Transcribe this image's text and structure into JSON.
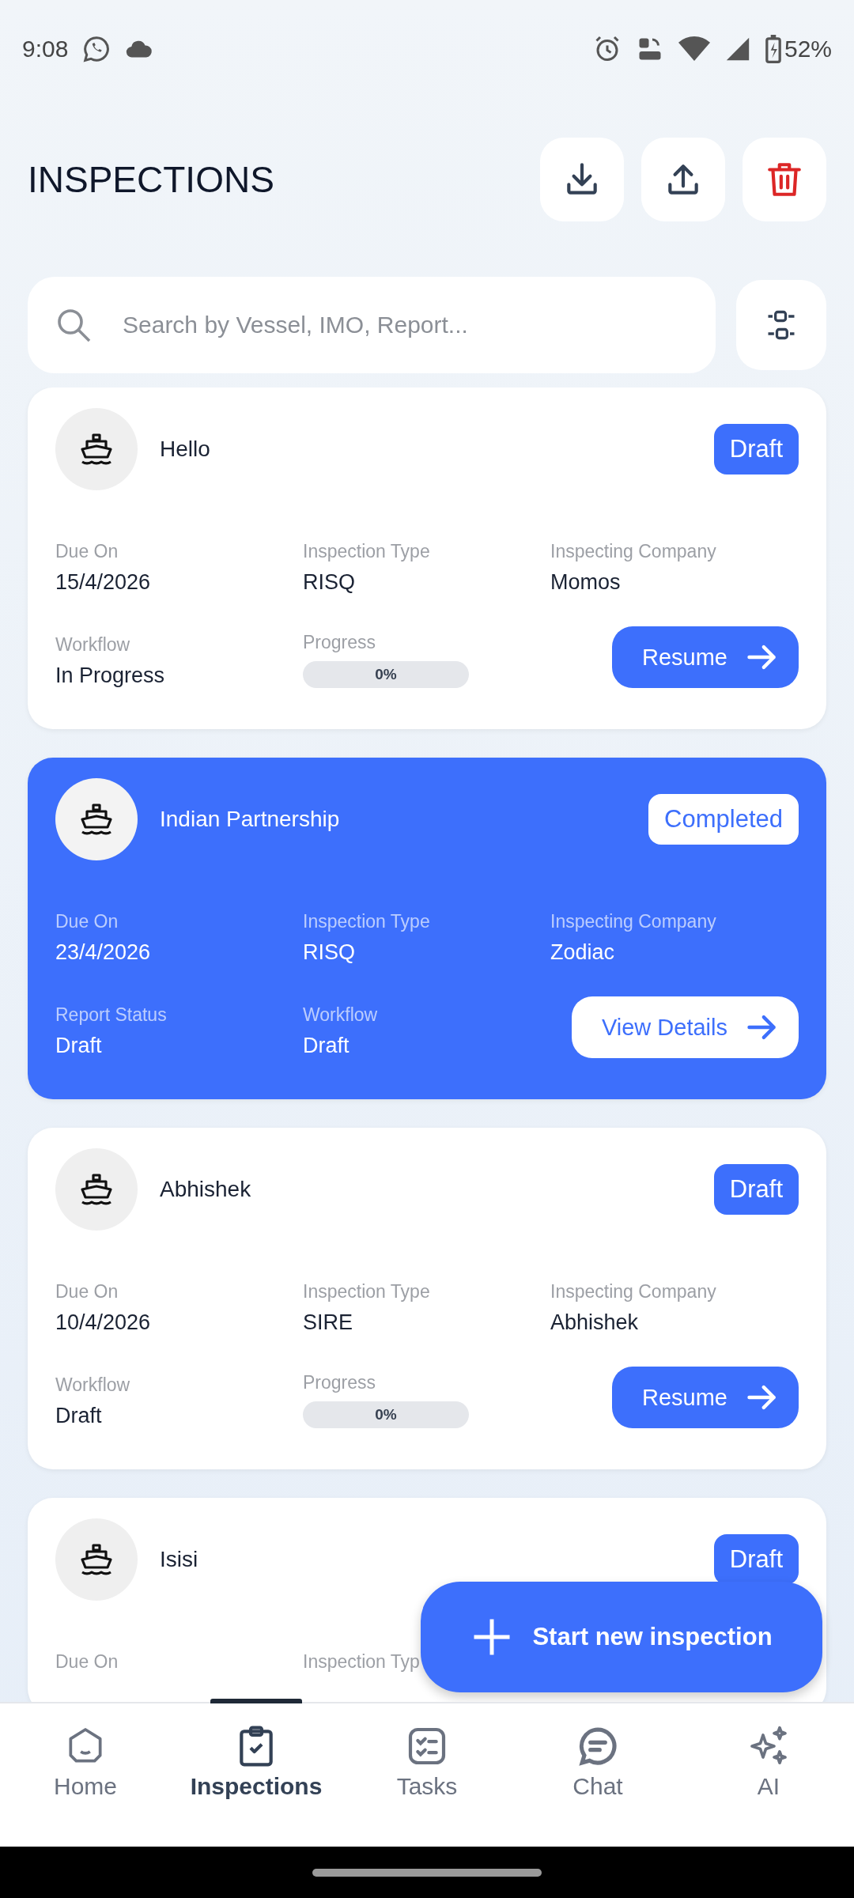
{
  "status_bar": {
    "time": "9:08",
    "battery": "52%"
  },
  "header": {
    "title": "INSPECTIONS"
  },
  "search": {
    "placeholder": "Search by Vessel, IMO, Report..."
  },
  "cards": [
    {
      "name": "Hello",
      "status": "Draft",
      "selected": false,
      "fields": [
        {
          "label": "Due On",
          "value": "15/4/2026"
        },
        {
          "label": "Inspection Type",
          "value": "RISQ"
        },
        {
          "label": "Inspecting Company",
          "value": "Momos"
        },
        {
          "label": "Workflow",
          "value": "In Progress"
        },
        {
          "label": "Progress",
          "kind": "progress",
          "level": 0,
          "reading": "0%"
        }
      ],
      "action": "Resume"
    },
    {
      "name": "Indian Partnership",
      "status": "Completed",
      "selected": true,
      "fields": [
        {
          "label": "Due On",
          "value": "23/4/2026"
        },
        {
          "label": "Inspection Type",
          "value": "RISQ"
        },
        {
          "label": "Inspecting Company",
          "value": "Zodiac"
        },
        {
          "label": "Report Status",
          "value": "Draft"
        },
        {
          "label": "Workflow",
          "value": "Draft"
        }
      ],
      "action": "View Details"
    },
    {
      "name": "Abhishek",
      "status": "Draft",
      "selected": false,
      "fields": [
        {
          "label": "Due On",
          "value": "10/4/2026"
        },
        {
          "label": "Inspection Type",
          "value": "SIRE"
        },
        {
          "label": "Inspecting Company",
          "value": "Abhishek"
        },
        {
          "label": "Workflow",
          "value": "Draft"
        },
        {
          "label": "Progress",
          "kind": "progress",
          "level": 0,
          "reading": "0%"
        }
      ],
      "action": "Resume"
    },
    {
      "name": "Isisi",
      "status": "Draft",
      "selected": false,
      "fields": [
        {
          "label": "Due On"
        },
        {
          "label": "Inspection Typ"
        }
      ]
    }
  ],
  "fab": {
    "label": "Start new inspection"
  },
  "nav": [
    {
      "label": "Home",
      "selected": false
    },
    {
      "label": "Inspections",
      "selected": true
    },
    {
      "label": "Tasks",
      "selected": false
    },
    {
      "label": "Chat",
      "selected": false
    },
    {
      "label": "AI",
      "selected": false
    }
  ]
}
